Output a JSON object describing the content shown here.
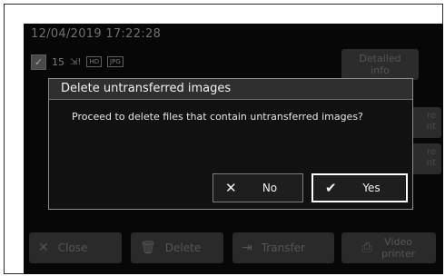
{
  "status": {
    "datetime": "12/04/2019 17:22:28",
    "selected_count": "15",
    "format_tags": [
      "HD",
      "JPG"
    ]
  },
  "side_buttons": {
    "detailed_info": "Detailed info",
    "partial_label_1": "re\nnt",
    "partial_label_2": "re\nnt"
  },
  "bottom_bar": {
    "close": "Close",
    "delete": "Delete",
    "transfer": "Transfer",
    "video_printer": "Video printer"
  },
  "dialog": {
    "title": "Delete untransferred images",
    "message": "Proceed to delete files that contain untransferred images?",
    "no_label": "No",
    "yes_label": "Yes"
  },
  "icons": {
    "close": "close-x-icon",
    "delete": "trash-icon",
    "transfer": "transfer-arrow-icon",
    "printer": "printer-icon",
    "check": "checkmark-icon"
  },
  "colors": {
    "screen_background": "#070707",
    "dialog_title_bar": "#2f2f2f",
    "dialog_border": "#8b8b8b",
    "selected_border": "#ffffff"
  }
}
